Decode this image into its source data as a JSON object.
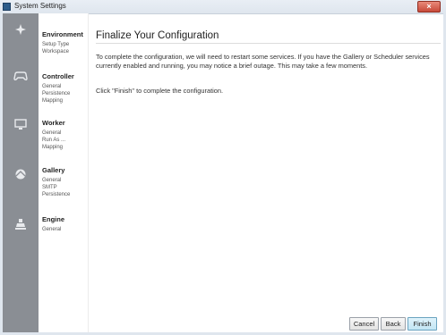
{
  "window": {
    "title": "System Settings",
    "close_glyph": "×"
  },
  "rail": {
    "icons": [
      "environment-icon",
      "controller-icon",
      "worker-icon",
      "gallery-icon",
      "engine-icon"
    ]
  },
  "nav": {
    "sections": [
      {
        "label": "Environment",
        "items": [
          "Setup Type",
          "Workspace"
        ]
      },
      {
        "label": "Controller",
        "items": [
          "General",
          "Persistence",
          "Mapping"
        ]
      },
      {
        "label": "Worker",
        "items": [
          "General",
          "Run As ...",
          "Mapping"
        ]
      },
      {
        "label": "Gallery",
        "items": [
          "General",
          "SMTP",
          "Persistence"
        ]
      },
      {
        "label": "Engine",
        "items": [
          "General"
        ]
      }
    ]
  },
  "main": {
    "title": "Finalize Your Configuration",
    "paragraph": "To complete the configuration, we will need to restart some services. If you have the Gallery or Scheduler services currently enabled and running, you may notice a brief outage. This may take a few moments.",
    "instruction": "Click \"Finish\" to complete the configuration."
  },
  "buttons": {
    "cancel": "Cancel",
    "back": "Back",
    "finish": "Finish"
  },
  "colors": {
    "rail": "#8a8e94",
    "primary_button": "#c2e6f4"
  }
}
